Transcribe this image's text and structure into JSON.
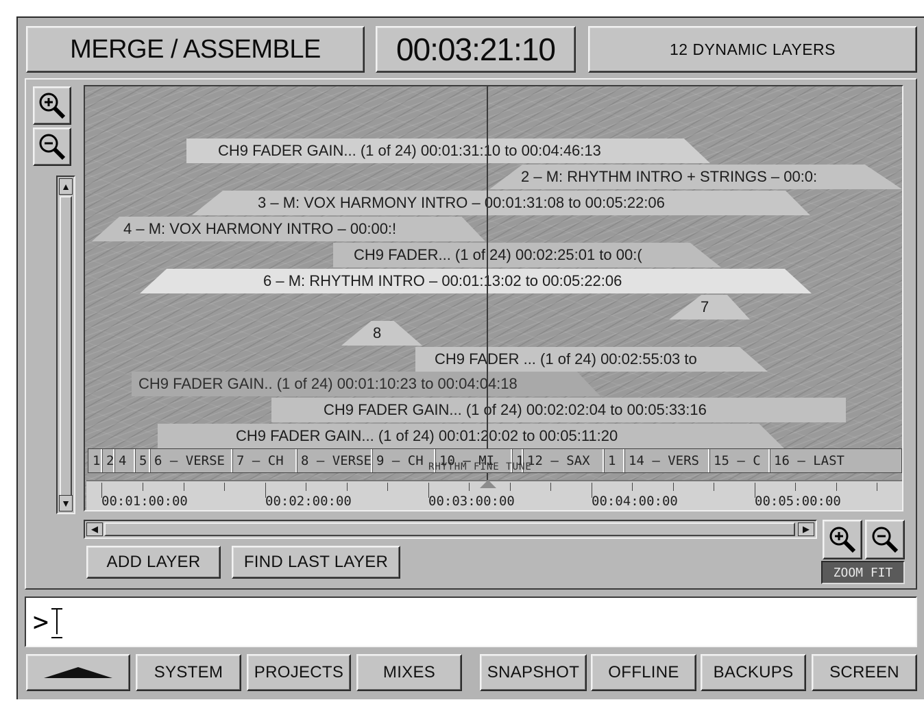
{
  "header": {
    "title": "MERGE / ASSEMBLE",
    "timecode": "00:03:21:10",
    "layers_count": "12 DYNAMIC LAYERS"
  },
  "layers": [
    {
      "label": "CH9 FADER GAIN... (1 of 24) 00:01:31:10 to 00:04:46:13"
    },
    {
      "label": "2 – M: RHYTHM INTRO + STRINGS – 00:0:"
    },
    {
      "label": "3 – M: VOX HARMONY INTRO – 00:01:31:08 to 00:05:22:06"
    },
    {
      "label": "4 – M: VOX HARMONY INTRO – 00:00:!"
    },
    {
      "label": "CH9 FADER... (1 of 24) 00:02:25:01 to 00:("
    },
    {
      "label": "6 – M: RHYTHM INTRO – 00:01:13:02 to 00:05:22:06"
    },
    {
      "label": "7"
    },
    {
      "label": "8"
    },
    {
      "label": "CH9 FADER ... (1 of 24) 00:02:55:03 to"
    },
    {
      "label": "CH9 FADER GAIN.. (1 of 24) 00:01:10:23 to 00:04:04:18"
    },
    {
      "label": "CH9 FADER GAIN... (1 of 24) 00:02:02:04 to 00:05:33:16"
    },
    {
      "label": "CH9 FADER GAIN... (1 of 24) 00:01:20:02 to 00:05:11:20"
    }
  ],
  "markers": [
    {
      "label": "1"
    },
    {
      "label": "2"
    },
    {
      "label": "4"
    },
    {
      "label": "5"
    },
    {
      "label": "6 – VERSE"
    },
    {
      "label": "7 – CH"
    },
    {
      "label": "8 – VERSE"
    },
    {
      "label": "9 – CH"
    },
    {
      "label": "10 – MI"
    },
    {
      "label": "1"
    },
    {
      "label": "12 – SAX"
    },
    {
      "label": "1"
    },
    {
      "label": "14 – VERS"
    },
    {
      "label": "15 – C"
    },
    {
      "label": "16 – LAST"
    }
  ],
  "marker_subtitle": "RHYTHM FINE TUNE",
  "ruler": [
    "00:01:00:00",
    "00:02:00:00",
    "00:03:00:00",
    "00:04:00:00",
    "00:05:00:00"
  ],
  "buttons": {
    "add_layer": "ADD LAYER",
    "find_last_layer": "FIND LAST LAYER",
    "zoom_fit": "ZOOM FIT"
  },
  "command": {
    "prompt": ">"
  },
  "nav": [
    "SYSTEM",
    "PROJECTS",
    "MIXES",
    "SNAPSHOT",
    "OFFLINE",
    "BACKUPS",
    "SCREEN"
  ],
  "colors": {
    "panel": "#b8b8b8",
    "timeline_bg": "#9a9a9a",
    "layer_light": "#d6d6d6",
    "layer_mid": "#bcbcbc",
    "layer_dark": "#a9a9a9"
  }
}
